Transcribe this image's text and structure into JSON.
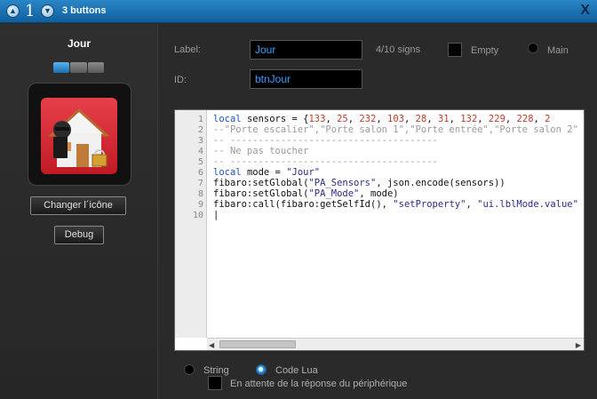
{
  "titlebar": {
    "counter": "1",
    "title": "3 buttons",
    "close": "X",
    "up_glyph": "▲",
    "down_glyph": "▼"
  },
  "left": {
    "icon_name": "Jour",
    "change_icon_label": "Changer l´icône",
    "debug_label": "Debug"
  },
  "form": {
    "label_caption": "Label:",
    "label_value": "Jour",
    "signs": "4/10 signs",
    "empty_label": "Empty",
    "main_label": "Main",
    "id_caption": "ID:",
    "id_value": "btnJour"
  },
  "editor": {
    "line_numbers": [
      "1",
      "2",
      "3",
      "4",
      "5",
      "6",
      "7",
      "8",
      "9",
      "10"
    ]
  },
  "bottom": {
    "string_label": "String",
    "lua_label": "Code Lua",
    "lua_selected": true,
    "wait_label": "En attente de la réponse du périphérique"
  },
  "colors": {
    "accent": "#1e6fb0",
    "field_text": "#3aa0ff",
    "titlebar": "#1a70b0"
  }
}
